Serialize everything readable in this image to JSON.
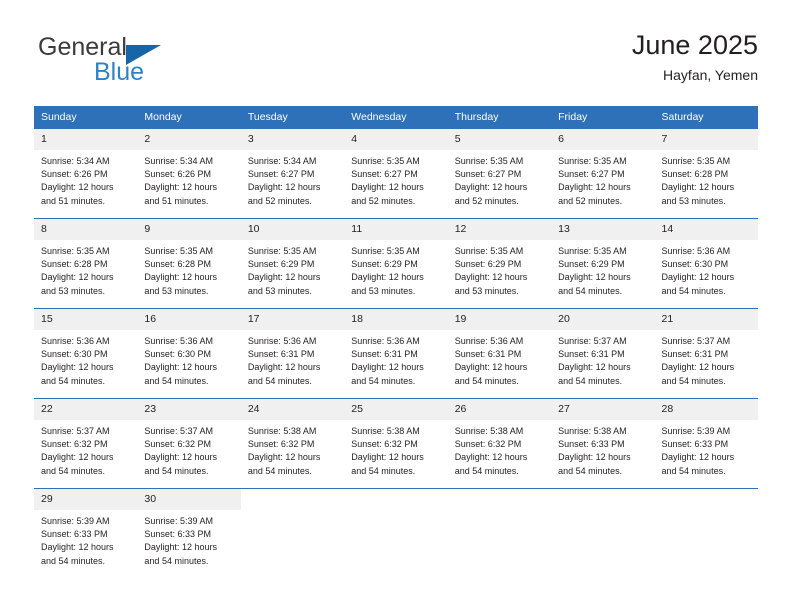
{
  "brand": {
    "name_top": "General",
    "name_bottom": "Blue",
    "triangle_color": "#1565a8",
    "blue_color": "#2b82c9"
  },
  "header": {
    "title": "June 2025",
    "subtitle": "Hayfan, Yemen"
  },
  "theme": {
    "header_blue": "#2e71b8",
    "daynum_bg": "#f0f0f0",
    "text": "#231f20"
  },
  "columns": [
    "Sunday",
    "Monday",
    "Tuesday",
    "Wednesday",
    "Thursday",
    "Friday",
    "Saturday"
  ],
  "weeks": [
    [
      {
        "day": "1",
        "sunrise": "Sunrise: 5:34 AM",
        "sunset": "Sunset: 6:26 PM",
        "daylight1": "Daylight: 12 hours",
        "daylight2": "and 51 minutes."
      },
      {
        "day": "2",
        "sunrise": "Sunrise: 5:34 AM",
        "sunset": "Sunset: 6:26 PM",
        "daylight1": "Daylight: 12 hours",
        "daylight2": "and 51 minutes."
      },
      {
        "day": "3",
        "sunrise": "Sunrise: 5:34 AM",
        "sunset": "Sunset: 6:27 PM",
        "daylight1": "Daylight: 12 hours",
        "daylight2": "and 52 minutes."
      },
      {
        "day": "4",
        "sunrise": "Sunrise: 5:35 AM",
        "sunset": "Sunset: 6:27 PM",
        "daylight1": "Daylight: 12 hours",
        "daylight2": "and 52 minutes."
      },
      {
        "day": "5",
        "sunrise": "Sunrise: 5:35 AM",
        "sunset": "Sunset: 6:27 PM",
        "daylight1": "Daylight: 12 hours",
        "daylight2": "and 52 minutes."
      },
      {
        "day": "6",
        "sunrise": "Sunrise: 5:35 AM",
        "sunset": "Sunset: 6:27 PM",
        "daylight1": "Daylight: 12 hours",
        "daylight2": "and 52 minutes."
      },
      {
        "day": "7",
        "sunrise": "Sunrise: 5:35 AM",
        "sunset": "Sunset: 6:28 PM",
        "daylight1": "Daylight: 12 hours",
        "daylight2": "and 53 minutes."
      }
    ],
    [
      {
        "day": "8",
        "sunrise": "Sunrise: 5:35 AM",
        "sunset": "Sunset: 6:28 PM",
        "daylight1": "Daylight: 12 hours",
        "daylight2": "and 53 minutes."
      },
      {
        "day": "9",
        "sunrise": "Sunrise: 5:35 AM",
        "sunset": "Sunset: 6:28 PM",
        "daylight1": "Daylight: 12 hours",
        "daylight2": "and 53 minutes."
      },
      {
        "day": "10",
        "sunrise": "Sunrise: 5:35 AM",
        "sunset": "Sunset: 6:29 PM",
        "daylight1": "Daylight: 12 hours",
        "daylight2": "and 53 minutes."
      },
      {
        "day": "11",
        "sunrise": "Sunrise: 5:35 AM",
        "sunset": "Sunset: 6:29 PM",
        "daylight1": "Daylight: 12 hours",
        "daylight2": "and 53 minutes."
      },
      {
        "day": "12",
        "sunrise": "Sunrise: 5:35 AM",
        "sunset": "Sunset: 6:29 PM",
        "daylight1": "Daylight: 12 hours",
        "daylight2": "and 53 minutes."
      },
      {
        "day": "13",
        "sunrise": "Sunrise: 5:35 AM",
        "sunset": "Sunset: 6:29 PM",
        "daylight1": "Daylight: 12 hours",
        "daylight2": "and 54 minutes."
      },
      {
        "day": "14",
        "sunrise": "Sunrise: 5:36 AM",
        "sunset": "Sunset: 6:30 PM",
        "daylight1": "Daylight: 12 hours",
        "daylight2": "and 54 minutes."
      }
    ],
    [
      {
        "day": "15",
        "sunrise": "Sunrise: 5:36 AM",
        "sunset": "Sunset: 6:30 PM",
        "daylight1": "Daylight: 12 hours",
        "daylight2": "and 54 minutes."
      },
      {
        "day": "16",
        "sunrise": "Sunrise: 5:36 AM",
        "sunset": "Sunset: 6:30 PM",
        "daylight1": "Daylight: 12 hours",
        "daylight2": "and 54 minutes."
      },
      {
        "day": "17",
        "sunrise": "Sunrise: 5:36 AM",
        "sunset": "Sunset: 6:31 PM",
        "daylight1": "Daylight: 12 hours",
        "daylight2": "and 54 minutes."
      },
      {
        "day": "18",
        "sunrise": "Sunrise: 5:36 AM",
        "sunset": "Sunset: 6:31 PM",
        "daylight1": "Daylight: 12 hours",
        "daylight2": "and 54 minutes."
      },
      {
        "day": "19",
        "sunrise": "Sunrise: 5:36 AM",
        "sunset": "Sunset: 6:31 PM",
        "daylight1": "Daylight: 12 hours",
        "daylight2": "and 54 minutes."
      },
      {
        "day": "20",
        "sunrise": "Sunrise: 5:37 AM",
        "sunset": "Sunset: 6:31 PM",
        "daylight1": "Daylight: 12 hours",
        "daylight2": "and 54 minutes."
      },
      {
        "day": "21",
        "sunrise": "Sunrise: 5:37 AM",
        "sunset": "Sunset: 6:31 PM",
        "daylight1": "Daylight: 12 hours",
        "daylight2": "and 54 minutes."
      }
    ],
    [
      {
        "day": "22",
        "sunrise": "Sunrise: 5:37 AM",
        "sunset": "Sunset: 6:32 PM",
        "daylight1": "Daylight: 12 hours",
        "daylight2": "and 54 minutes."
      },
      {
        "day": "23",
        "sunrise": "Sunrise: 5:37 AM",
        "sunset": "Sunset: 6:32 PM",
        "daylight1": "Daylight: 12 hours",
        "daylight2": "and 54 minutes."
      },
      {
        "day": "24",
        "sunrise": "Sunrise: 5:38 AM",
        "sunset": "Sunset: 6:32 PM",
        "daylight1": "Daylight: 12 hours",
        "daylight2": "and 54 minutes."
      },
      {
        "day": "25",
        "sunrise": "Sunrise: 5:38 AM",
        "sunset": "Sunset: 6:32 PM",
        "daylight1": "Daylight: 12 hours",
        "daylight2": "and 54 minutes."
      },
      {
        "day": "26",
        "sunrise": "Sunrise: 5:38 AM",
        "sunset": "Sunset: 6:32 PM",
        "daylight1": "Daylight: 12 hours",
        "daylight2": "and 54 minutes."
      },
      {
        "day": "27",
        "sunrise": "Sunrise: 5:38 AM",
        "sunset": "Sunset: 6:33 PM",
        "daylight1": "Daylight: 12 hours",
        "daylight2": "and 54 minutes."
      },
      {
        "day": "28",
        "sunrise": "Sunrise: 5:39 AM",
        "sunset": "Sunset: 6:33 PM",
        "daylight1": "Daylight: 12 hours",
        "daylight2": "and 54 minutes."
      }
    ],
    [
      {
        "day": "29",
        "sunrise": "Sunrise: 5:39 AM",
        "sunset": "Sunset: 6:33 PM",
        "daylight1": "Daylight: 12 hours",
        "daylight2": "and 54 minutes."
      },
      {
        "day": "30",
        "sunrise": "Sunrise: 5:39 AM",
        "sunset": "Sunset: 6:33 PM",
        "daylight1": "Daylight: 12 hours",
        "daylight2": "and 54 minutes."
      },
      {
        "day": "",
        "sunrise": "",
        "sunset": "",
        "daylight1": "",
        "daylight2": ""
      },
      {
        "day": "",
        "sunrise": "",
        "sunset": "",
        "daylight1": "",
        "daylight2": ""
      },
      {
        "day": "",
        "sunrise": "",
        "sunset": "",
        "daylight1": "",
        "daylight2": ""
      },
      {
        "day": "",
        "sunrise": "",
        "sunset": "",
        "daylight1": "",
        "daylight2": ""
      },
      {
        "day": "",
        "sunrise": "",
        "sunset": "",
        "daylight1": "",
        "daylight2": ""
      }
    ]
  ]
}
